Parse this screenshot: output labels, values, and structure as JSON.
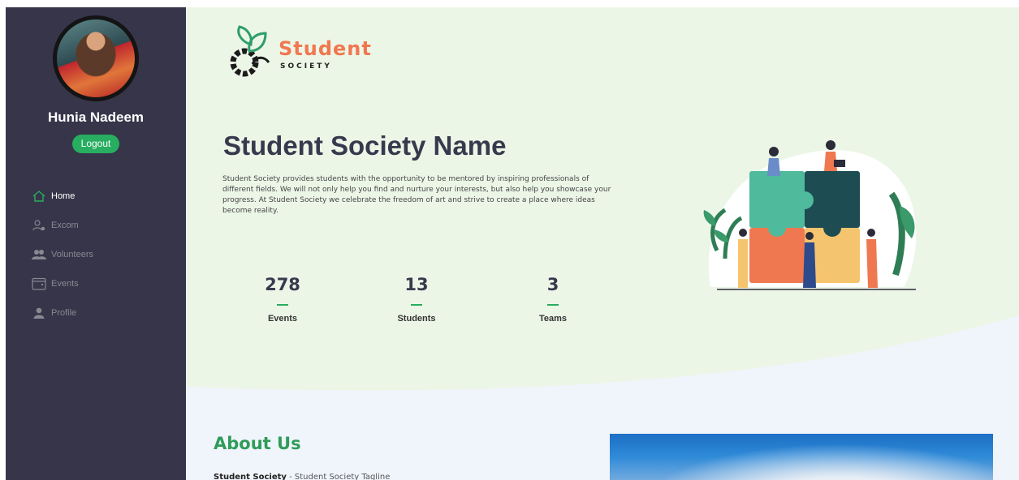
{
  "sidebar": {
    "user_name": "Hunia Nadeem",
    "logout_label": "Logout",
    "nav": [
      {
        "label": "Home",
        "icon": "home-icon",
        "active": true
      },
      {
        "label": "Excom",
        "icon": "users-gear-icon",
        "active": false
      },
      {
        "label": "Volunteers",
        "icon": "people-icon",
        "active": false
      },
      {
        "label": "Events",
        "icon": "calendar-icon",
        "active": false
      },
      {
        "label": "Profile",
        "icon": "person-icon",
        "active": false
      }
    ]
  },
  "logo": {
    "title": "Student",
    "subtitle": "SOCIETY"
  },
  "hero": {
    "title": "Student Society Name",
    "description": "Student Society provides students with the opportunity to be mentored by inspiring professionals of different fields. We will not only help you find and nurture your interests, but also help you showcase your progress. At Student Society we celebrate the freedom of art and strive to create a place where ideas become reality."
  },
  "stats": [
    {
      "value": "278",
      "label": "Events"
    },
    {
      "value": "13",
      "label": "Students"
    },
    {
      "value": "3",
      "label": "Teams"
    }
  ],
  "about": {
    "title": "About Us",
    "name": "Student Society",
    "tagline": "- Student Society Tagline"
  },
  "colors": {
    "sidebar_bg": "#37354a",
    "accent_green": "#27ae60",
    "hero_bg": "#ecf6e7",
    "logo_orange": "#f07850"
  }
}
